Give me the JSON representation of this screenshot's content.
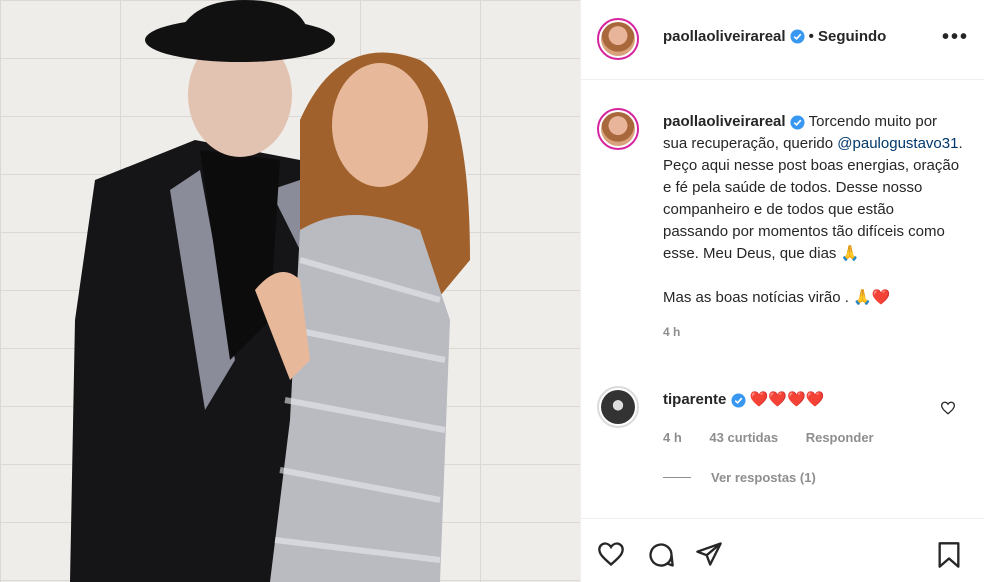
{
  "header": {
    "username": "paollaoliveirareal",
    "follow_text": "• Seguindo",
    "more_icon": "more-horizontal-icon"
  },
  "caption": {
    "username": "paollaoliveirareal",
    "text_before": "Torcendo muito por sua recuperação, querido",
    "mention": "@paulogustavo31",
    "text_after": ". Peço aqui nesse post boas energias, oração e fé pela saúde de todos. Desse nosso companheiro e de todos que estão passando por momentos tão difíceis como esse. Meu Deus, que dias 🙏",
    "text_line2": "Mas as boas notícias virão . 🙏❤️",
    "time": "4 h"
  },
  "comment": {
    "username": "tiparente",
    "text": "❤️❤️❤️❤️",
    "time": "4 h",
    "likes": "43 curtidas",
    "reply": "Responder",
    "view_replies": "Ver respostas (1)"
  },
  "actions": {
    "like_icon": "heart-icon",
    "comment_icon": "comment-icon",
    "share_icon": "send-icon",
    "save_icon": "bookmark-icon"
  },
  "colors": {
    "text": "#262626",
    "secondary": "#8e8e8e",
    "mention": "#00376b",
    "verified": "#3897f0",
    "heart": "#ed4956"
  }
}
